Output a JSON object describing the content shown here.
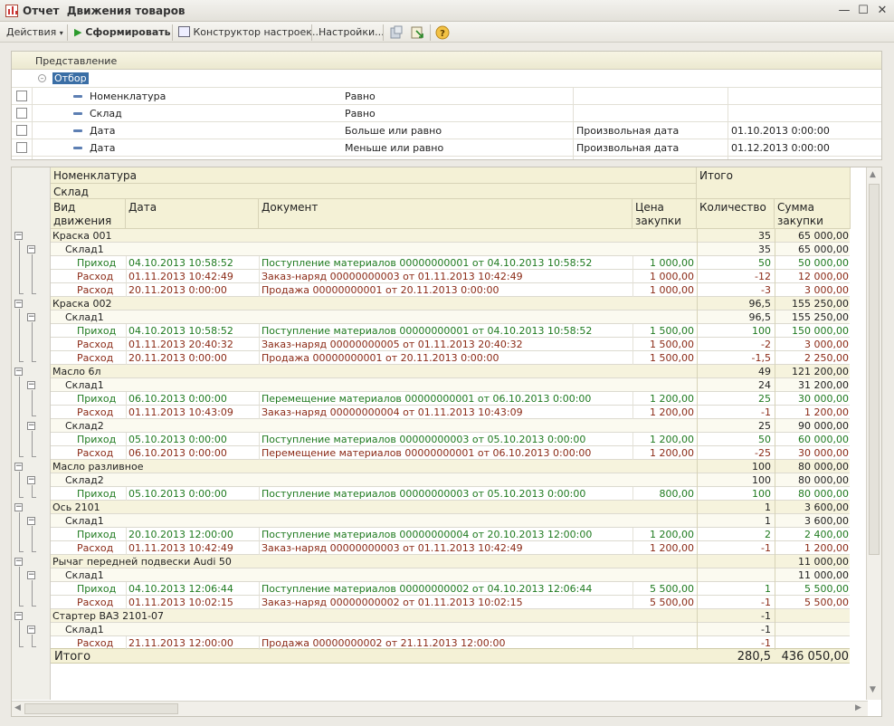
{
  "window": {
    "title_prefix": "Отчет",
    "title": "Движения товаров"
  },
  "toolbar": {
    "actions_label": "Действия",
    "generate_label": "Сформировать",
    "constructor_label": "Конструктор настроек...",
    "settings_label": "Настройки..."
  },
  "filter": {
    "header": "Представление",
    "root_label": "Отбор",
    "rows": [
      {
        "field": "Номенклатура",
        "condition": "Равно",
        "type": "",
        "value": ""
      },
      {
        "field": "Склад",
        "condition": "Равно",
        "type": "",
        "value": ""
      },
      {
        "field": "Дата",
        "condition": "Больше или равно",
        "type": "Произвольная дата",
        "value": "01.10.2013 0:00:00"
      },
      {
        "field": "Дата",
        "condition": "Меньше или равно",
        "type": "Произвольная дата",
        "value": "01.12.2013 0:00:00"
      }
    ]
  },
  "report": {
    "headers": {
      "nomenclature": "Номенклатура",
      "warehouse": "Склад",
      "movement_type": "Вид движения",
      "date": "Дата",
      "document": "Документ",
      "price": "Цена закупки",
      "total_group": "Итого",
      "quantity": "Количество",
      "sum": "Сумма закупки"
    },
    "rows": [
      {
        "level": 0,
        "name": "Краска 001",
        "qty": "35",
        "sum": "65 000,00"
      },
      {
        "level": 1,
        "name": "Склад1",
        "qty": "35",
        "sum": "65 000,00"
      },
      {
        "level": 2,
        "kind": "in",
        "type": "Приход",
        "date": "04.10.2013 10:58:52",
        "doc": "Поступление материалов 00000000001 от 04.10.2013 10:58:52",
        "price": "1 000,00",
        "qty": "50",
        "sum": "50 000,00"
      },
      {
        "level": 2,
        "kind": "out",
        "type": "Расход",
        "date": "01.11.2013 10:42:49",
        "doc": "Заказ-наряд 00000000003 от 01.11.2013 10:42:49",
        "price": "1 000,00",
        "qty": "-12",
        "sum": "12 000,00"
      },
      {
        "level": 2,
        "kind": "out",
        "type": "Расход",
        "date": "20.11.2013 0:00:00",
        "doc": "Продажа 00000000001 от 20.11.2013 0:00:00",
        "price": "1 000,00",
        "qty": "-3",
        "sum": "3 000,00"
      },
      {
        "level": 0,
        "name": "Краска 002",
        "qty": "96,5",
        "sum": "155 250,00"
      },
      {
        "level": 1,
        "name": "Склад1",
        "qty": "96,5",
        "sum": "155 250,00"
      },
      {
        "level": 2,
        "kind": "in",
        "type": "Приход",
        "date": "04.10.2013 10:58:52",
        "doc": "Поступление материалов 00000000001 от 04.10.2013 10:58:52",
        "price": "1 500,00",
        "qty": "100",
        "sum": "150 000,00"
      },
      {
        "level": 2,
        "kind": "out",
        "type": "Расход",
        "date": "01.11.2013 20:40:32",
        "doc": "Заказ-наряд 00000000005 от 01.11.2013 20:40:32",
        "price": "1 500,00",
        "qty": "-2",
        "sum": "3 000,00"
      },
      {
        "level": 2,
        "kind": "out",
        "type": "Расход",
        "date": "20.11.2013 0:00:00",
        "doc": "Продажа 00000000001 от 20.11.2013 0:00:00",
        "price": "1 500,00",
        "qty": "-1,5",
        "sum": "2 250,00"
      },
      {
        "level": 0,
        "name": "Масло 6л",
        "qty": "49",
        "sum": "121 200,00"
      },
      {
        "level": 1,
        "name": "Склад1",
        "qty": "24",
        "sum": "31 200,00"
      },
      {
        "level": 2,
        "kind": "in",
        "type": "Приход",
        "date": "06.10.2013 0:00:00",
        "doc": "Перемещение материалов 00000000001 от 06.10.2013 0:00:00",
        "price": "1 200,00",
        "qty": "25",
        "sum": "30 000,00"
      },
      {
        "level": 2,
        "kind": "out",
        "type": "Расход",
        "date": "01.11.2013 10:43:09",
        "doc": "Заказ-наряд 00000000004 от 01.11.2013 10:43:09",
        "price": "1 200,00",
        "qty": "-1",
        "sum": "1 200,00"
      },
      {
        "level": 1,
        "name": "Склад2",
        "qty": "25",
        "sum": "90 000,00"
      },
      {
        "level": 2,
        "kind": "in",
        "type": "Приход",
        "date": "05.10.2013 0:00:00",
        "doc": "Поступление материалов 00000000003 от 05.10.2013 0:00:00",
        "price": "1 200,00",
        "qty": "50",
        "sum": "60 000,00"
      },
      {
        "level": 2,
        "kind": "out",
        "type": "Расход",
        "date": "06.10.2013 0:00:00",
        "doc": "Перемещение материалов 00000000001 от 06.10.2013 0:00:00",
        "price": "1 200,00",
        "qty": "-25",
        "sum": "30 000,00"
      },
      {
        "level": 0,
        "name": "Масло разливное",
        "qty": "100",
        "sum": "80 000,00"
      },
      {
        "level": 1,
        "name": "Склад2",
        "qty": "100",
        "sum": "80 000,00"
      },
      {
        "level": 2,
        "kind": "in",
        "type": "Приход",
        "date": "05.10.2013 0:00:00",
        "doc": "Поступление материалов 00000000003 от 05.10.2013 0:00:00",
        "price": "800,00",
        "qty": "100",
        "sum": "80 000,00"
      },
      {
        "level": 0,
        "name": "Ось 2101",
        "qty": "1",
        "sum": "3 600,00"
      },
      {
        "level": 1,
        "name": "Склад1",
        "qty": "1",
        "sum": "3 600,00"
      },
      {
        "level": 2,
        "kind": "in",
        "type": "Приход",
        "date": "20.10.2013 12:00:00",
        "doc": "Поступление материалов 00000000004 от 20.10.2013 12:00:00",
        "price": "1 200,00",
        "qty": "2",
        "sum": "2 400,00"
      },
      {
        "level": 2,
        "kind": "out",
        "type": "Расход",
        "date": "01.11.2013 10:42:49",
        "doc": "Заказ-наряд 00000000003 от 01.11.2013 10:42:49",
        "price": "1 200,00",
        "qty": "-1",
        "sum": "1 200,00"
      },
      {
        "level": 0,
        "name": "Рычаг передней подвески Audi 50",
        "qty": "",
        "sum": "11 000,00"
      },
      {
        "level": 1,
        "name": "Склад1",
        "qty": "",
        "sum": "11 000,00"
      },
      {
        "level": 2,
        "kind": "in",
        "type": "Приход",
        "date": "04.10.2013 12:06:44",
        "doc": "Поступление материалов 00000000002 от 04.10.2013 12:06:44",
        "price": "5 500,00",
        "qty": "1",
        "sum": "5 500,00"
      },
      {
        "level": 2,
        "kind": "out",
        "type": "Расход",
        "date": "01.11.2013 10:02:15",
        "doc": "Заказ-наряд 00000000002 от 01.11.2013 10:02:15",
        "price": "5 500,00",
        "qty": "-1",
        "sum": "5 500,00"
      },
      {
        "level": 0,
        "name": "Стартер ВАЗ 2101-07",
        "qty": "-1",
        "sum": ""
      },
      {
        "level": 1,
        "name": "Склад1",
        "qty": "-1",
        "sum": ""
      },
      {
        "level": 2,
        "kind": "out",
        "type": "Расход",
        "date": "21.11.2013 12:00:00",
        "doc": "Продажа 00000000002 от 21.11.2013 12:00:00",
        "price": "",
        "qty": "-1",
        "sum": ""
      }
    ],
    "total": {
      "label": "Итого",
      "qty": "280,5",
      "sum": "436 050,00"
    }
  }
}
